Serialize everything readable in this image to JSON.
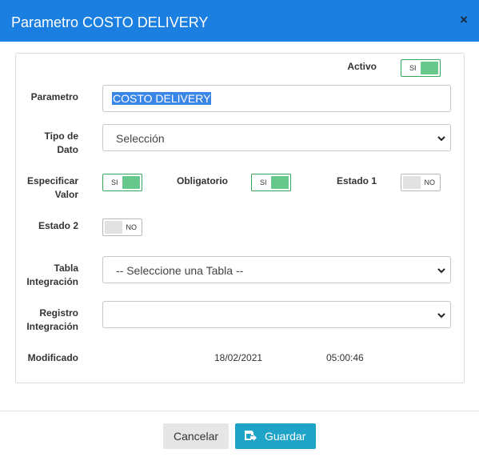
{
  "header": {
    "title": "Parametro COSTO DELIVERY",
    "close_symbol": "×"
  },
  "form": {
    "activo": {
      "label": "Activo",
      "toggle": "SI"
    },
    "parametro": {
      "label": "Parametro",
      "value": "COSTO DELIVERY"
    },
    "tipo_dato": {
      "label_line1": "Tipo de",
      "label_line2": "Dato",
      "selected": "Selección"
    },
    "especificar_valor": {
      "label_line1": "Especificar",
      "label_line2": "Valor",
      "toggle": "SI"
    },
    "obligatorio": {
      "label": "Obligatorio",
      "toggle": "SI"
    },
    "estado1": {
      "label": "Estado 1",
      "toggle": "NO"
    },
    "estado2": {
      "label": "Estado 2",
      "toggle": "NO"
    },
    "tabla_integracion": {
      "label_line1": "Tabla",
      "label_line2": "Integración",
      "selected": "-- Seleccione una Tabla --"
    },
    "registro_integracion": {
      "label_line1": "Registro",
      "label_line2": "Integración",
      "selected": ""
    },
    "modificado": {
      "label": "Modificado",
      "date": "18/02/2021",
      "time": "05:00:46"
    }
  },
  "footer": {
    "cancel_label": "Cancelar",
    "save_label": "Guardar"
  },
  "colors": {
    "header_bg": "#1a7fe0",
    "toggle_on": "#66c98b",
    "save_button": "#1fa3c6",
    "selection": "#3a86e6"
  }
}
